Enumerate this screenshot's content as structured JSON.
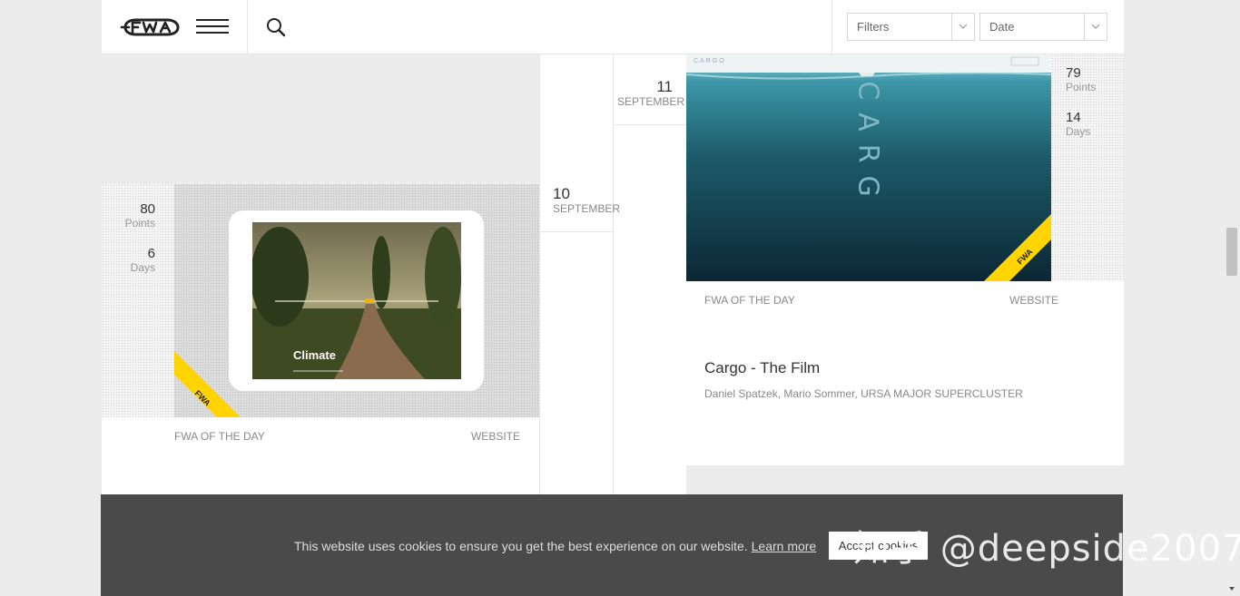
{
  "header": {
    "logo_icon": "fwa-logo",
    "menu_icon": "hamburger-icon",
    "search_icon": "search-icon",
    "filters": {
      "label": "Filters",
      "icon": "chevron-down-icon"
    },
    "date_select": {
      "label": "Date",
      "icon": "chevron-down-icon"
    }
  },
  "cards": [
    {
      "title": "Climate",
      "points": "80",
      "points_label": "Points",
      "days": "6",
      "days_label": "Days",
      "award": "FWA OF THE DAY",
      "category": "WEBSITE",
      "date_day": "10",
      "date_month": "SEPTEMBER"
    },
    {
      "title": "Cargo - The Film",
      "authors": "Daniel Spatzek, Mario Sommer, URSA MAJOR SUPERCLUSTER",
      "points": "79",
      "points_label": "Points",
      "days": "14",
      "days_label": "Days",
      "award": "FWA OF THE DAY",
      "category": "WEBSITE",
      "date_day": "11",
      "date_month": "SEPTEMBER",
      "thumb_brand": "CARGO",
      "thumb_word": "CARG"
    }
  ],
  "cookie": {
    "message": "This website uses cookies to ensure you get the best experience on our website.",
    "learn_more": "Learn more",
    "accept": "Accept cookies"
  },
  "watermark": "知乎 @deepside2007",
  "colors": {
    "accent": "#ffd400",
    "cookie_bg": "#4a4a4a",
    "page_bg": "#ececec"
  }
}
